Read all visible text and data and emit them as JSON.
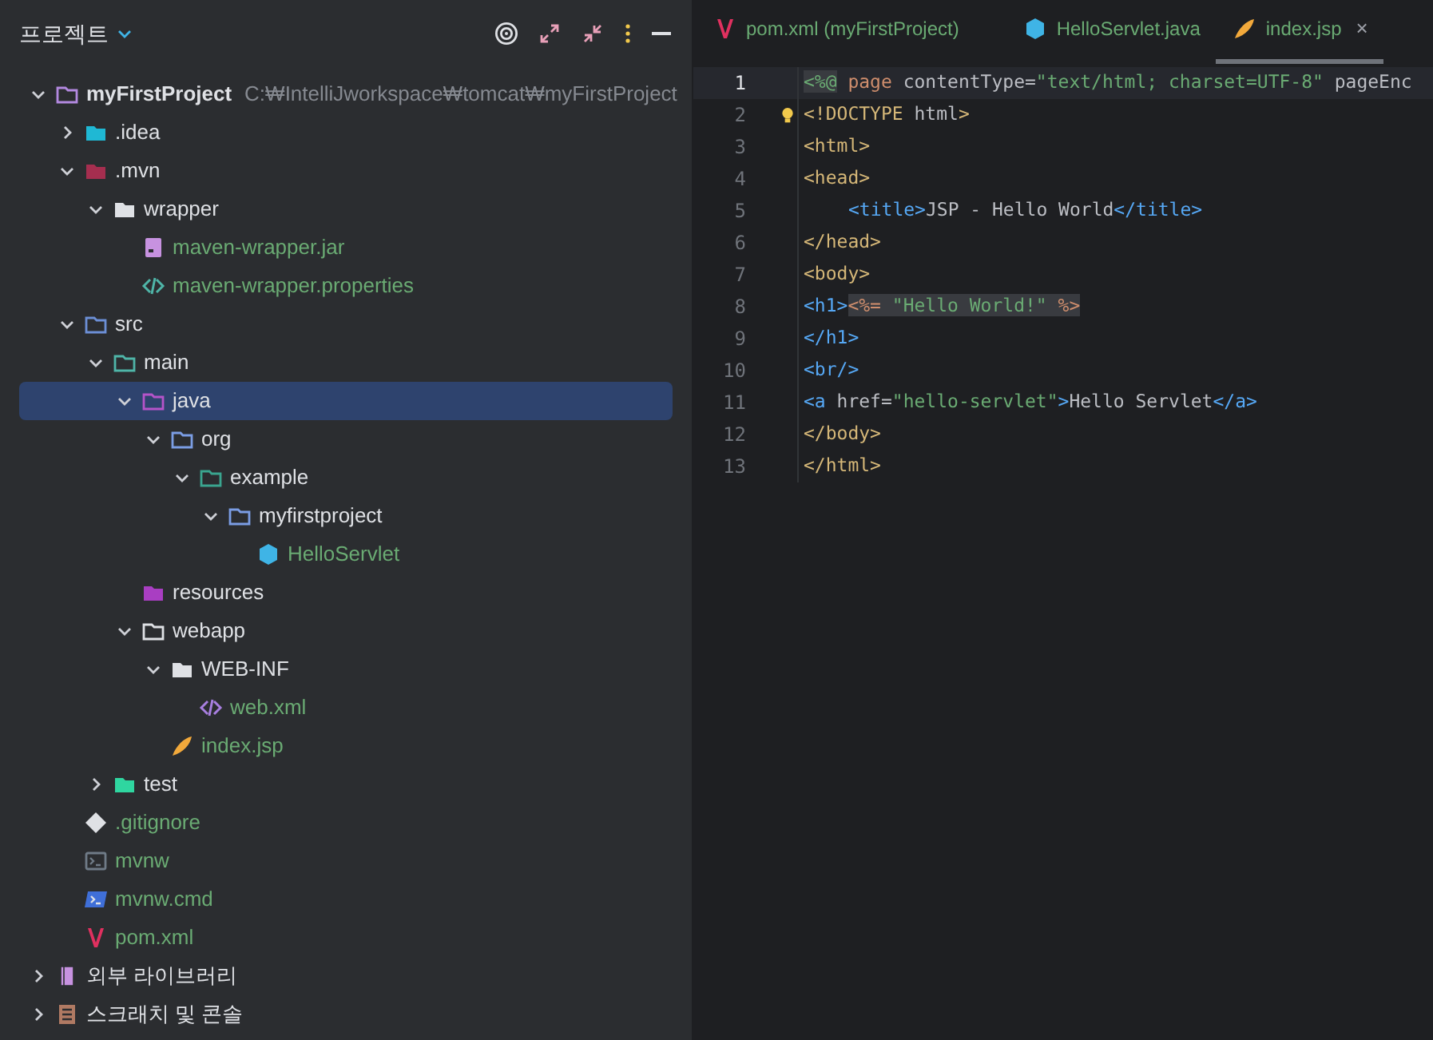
{
  "sidebar": {
    "title": "프로젝트",
    "tree": [
      {
        "name": "myFirstProject",
        "path": "C:₩IntelliJworkspace₩tomcat₩myFirstProject",
        "kind": "module",
        "expanded": true,
        "selected": false,
        "added": false,
        "children": [
          {
            "name": ".idea",
            "kind": "idea",
            "expanded": false,
            "selected": false,
            "added": false
          },
          {
            "name": ".mvn",
            "kind": "mvn",
            "expanded": true,
            "selected": false,
            "added": false,
            "children": [
              {
                "name": "wrapper",
                "kind": "folder",
                "expanded": true,
                "selected": false,
                "added": false,
                "children": [
                  {
                    "name": "maven-wrapper.jar",
                    "kind": "jar",
                    "selected": false,
                    "added": true
                  },
                  {
                    "name": "maven-wrapper.properties",
                    "kind": "code",
                    "selected": false,
                    "added": true
                  }
                ]
              }
            ]
          },
          {
            "name": "src",
            "kind": "src",
            "expanded": true,
            "selected": false,
            "added": false,
            "children": [
              {
                "name": "main",
                "kind": "main",
                "expanded": true,
                "selected": false,
                "added": false,
                "children": [
                  {
                    "name": "java",
                    "kind": "java-root",
                    "expanded": true,
                    "selected": true,
                    "added": false,
                    "children": [
                      {
                        "name": "org",
                        "kind": "package",
                        "expanded": true,
                        "selected": false,
                        "added": false,
                        "children": [
                          {
                            "name": "example",
                            "kind": "example",
                            "expanded": true,
                            "selected": false,
                            "added": false,
                            "children": [
                              {
                                "name": "myfirstproject",
                                "kind": "package",
                                "expanded": true,
                                "selected": false,
                                "added": false,
                                "children": [
                                  {
                                    "name": "HelloServlet",
                                    "kind": "class",
                                    "selected": false,
                                    "added": true
                                  }
                                ]
                              }
                            ]
                          }
                        ]
                      }
                    ]
                  },
                  {
                    "name": "resources",
                    "kind": "resources",
                    "selected": false,
                    "added": false
                  },
                  {
                    "name": "webapp",
                    "kind": "outline",
                    "expanded": true,
                    "selected": false,
                    "added": false,
                    "children": [
                      {
                        "name": "WEB-INF",
                        "kind": "folder",
                        "expanded": true,
                        "selected": false,
                        "added": false,
                        "children": [
                          {
                            "name": "web.xml",
                            "kind": "xml",
                            "selected": false,
                            "added": true
                          }
                        ]
                      },
                      {
                        "name": "index.jsp",
                        "kind": "jsp",
                        "selected": false,
                        "added": true
                      }
                    ]
                  }
                ]
              },
              {
                "name": "test",
                "kind": "test",
                "expanded": false,
                "selected": false,
                "added": false
              }
            ]
          },
          {
            "name": ".gitignore",
            "kind": "git",
            "selected": false,
            "added": true
          },
          {
            "name": "mvnw",
            "kind": "shell",
            "selected": false,
            "added": true
          },
          {
            "name": "mvnw.cmd",
            "kind": "cmd",
            "selected": false,
            "added": true
          },
          {
            "name": "pom.xml",
            "kind": "maven",
            "selected": false,
            "added": true
          }
        ]
      },
      {
        "name": "외부 라이브러리",
        "kind": "library",
        "expanded": false,
        "selected": false,
        "added": false
      },
      {
        "name": "스크래치 및 콘솔",
        "kind": "scratch",
        "expanded": false,
        "selected": false,
        "added": false
      }
    ]
  },
  "tabs": [
    {
      "label": "pom.xml (myFirstProject)",
      "kind": "maven",
      "selected": false
    },
    {
      "label": "HelloServlet.java",
      "kind": "class",
      "selected": false
    },
    {
      "label": "index.jsp",
      "kind": "jsp",
      "selected": true,
      "close": "×"
    }
  ],
  "editor": {
    "lines": [
      {
        "number": "1",
        "active": true,
        "indented": false,
        "hint": false,
        "tokens": [
          {
            "t": "<%@",
            "kind": "jsp",
            "highlighted": true
          },
          {
            "t": " page",
            "kind": "keyword",
            "highlighted": false
          },
          {
            "t": " contentType=",
            "kind": "text",
            "highlighted": false
          },
          {
            "t": "\"text/html; charset=UTF-8\"",
            "kind": "string",
            "highlighted": false
          },
          {
            "t": " pageEnc",
            "kind": "text",
            "highlighted": false
          }
        ]
      },
      {
        "number": "2",
        "active": false,
        "indented": false,
        "hint": true,
        "tokens": [
          {
            "t": "<!DOCTYPE",
            "kind": "tag",
            "highlighted": false
          },
          {
            "t": " html",
            "kind": "text",
            "highlighted": false
          },
          {
            "t": ">",
            "kind": "tag",
            "highlighted": false
          }
        ]
      },
      {
        "number": "3",
        "active": false,
        "indented": false,
        "hint": false,
        "tokens": [
          {
            "t": "<html>",
            "kind": "tag",
            "highlighted": false
          }
        ]
      },
      {
        "number": "4",
        "active": false,
        "indented": false,
        "hint": false,
        "tokens": [
          {
            "t": "<head>",
            "kind": "tag",
            "highlighted": false
          }
        ]
      },
      {
        "number": "5",
        "active": false,
        "indented": true,
        "hint": false,
        "tokens": [
          {
            "t": "<title>",
            "kind": "tag2",
            "highlighted": false
          },
          {
            "t": "JSP - Hello World",
            "kind": "text",
            "highlighted": false
          },
          {
            "t": "</title>",
            "kind": "tag2",
            "highlighted": false
          }
        ]
      },
      {
        "number": "6",
        "active": false,
        "indented": false,
        "hint": false,
        "tokens": [
          {
            "t": "</head>",
            "kind": "tag",
            "highlighted": false
          }
        ]
      },
      {
        "number": "7",
        "active": false,
        "indented": false,
        "hint": false,
        "tokens": [
          {
            "t": "<body>",
            "kind": "tag",
            "highlighted": false
          }
        ]
      },
      {
        "number": "8",
        "active": false,
        "indented": false,
        "hint": false,
        "tokens": [
          {
            "t": "<h1>",
            "kind": "tag2",
            "highlighted": false
          },
          {
            "t": "<%=",
            "kind": "keyword",
            "highlighted": true
          },
          {
            "t": " \"Hello World!\" ",
            "kind": "string",
            "highlighted": true
          },
          {
            "t": "%>",
            "kind": "keyword",
            "highlighted": true
          }
        ]
      },
      {
        "number": "9",
        "active": false,
        "indented": false,
        "hint": false,
        "tokens": [
          {
            "t": "</h1>",
            "kind": "tag2",
            "highlighted": false
          }
        ]
      },
      {
        "number": "10",
        "active": false,
        "indented": false,
        "hint": false,
        "tokens": [
          {
            "t": "<br/>",
            "kind": "tag2",
            "highlighted": false
          }
        ]
      },
      {
        "number": "11",
        "active": false,
        "indented": false,
        "hint": false,
        "tokens": [
          {
            "t": "<a",
            "kind": "tag2",
            "highlighted": false
          },
          {
            "t": " href=",
            "kind": "text",
            "highlighted": false
          },
          {
            "t": "\"hello-servlet\"",
            "kind": "string",
            "highlighted": false
          },
          {
            "t": ">",
            "kind": "tag2",
            "highlighted": false
          },
          {
            "t": "Hello Servlet",
            "kind": "text",
            "highlighted": false
          },
          {
            "t": "</a>",
            "kind": "tag2",
            "highlighted": false
          }
        ]
      },
      {
        "number": "12",
        "active": false,
        "indented": false,
        "hint": false,
        "tokens": [
          {
            "t": "</body>",
            "kind": "tag",
            "highlighted": false
          }
        ]
      },
      {
        "number": "13",
        "active": false,
        "indented": false,
        "hint": false,
        "tokens": [
          {
            "t": "</html>",
            "kind": "tag",
            "highlighted": false
          }
        ]
      }
    ]
  }
}
